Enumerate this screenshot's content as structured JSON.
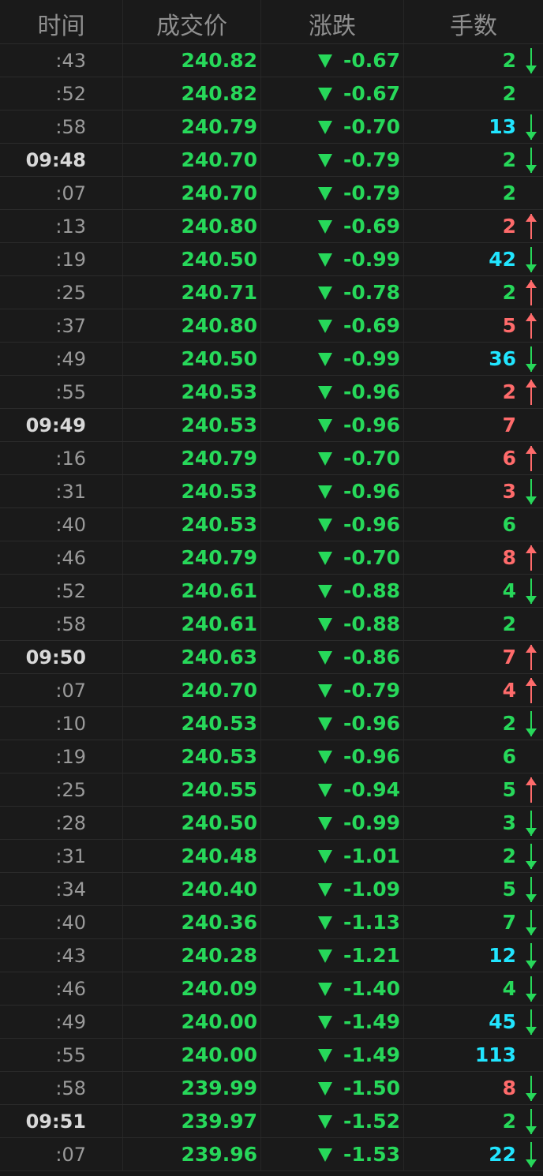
{
  "colors": {
    "background": "#1a1a1a",
    "header_text": "#8f8f8f",
    "time_text": "#9a9a9a",
    "minute_time_text": "#d8d8d8",
    "green": "#27d85a",
    "red": "#ff6b6b",
    "cyan": "#21e5ff"
  },
  "header": {
    "time": "时间",
    "price": "成交价",
    "change": "涨跌",
    "volume": "手数"
  },
  "rows": [
    {
      "time": ":43",
      "minute": false,
      "price": "240.82",
      "change": "-0.67",
      "volume": "2",
      "volume_color": "green",
      "arrow": "down"
    },
    {
      "time": ":52",
      "minute": false,
      "price": "240.82",
      "change": "-0.67",
      "volume": "2",
      "volume_color": "green",
      "arrow": ""
    },
    {
      "time": ":58",
      "minute": false,
      "price": "240.79",
      "change": "-0.70",
      "volume": "13",
      "volume_color": "cyan",
      "arrow": "down"
    },
    {
      "time": "09:48",
      "minute": true,
      "price": "240.70",
      "change": "-0.79",
      "volume": "2",
      "volume_color": "green",
      "arrow": "down"
    },
    {
      "time": ":07",
      "minute": false,
      "price": "240.70",
      "change": "-0.79",
      "volume": "2",
      "volume_color": "green",
      "arrow": ""
    },
    {
      "time": ":13",
      "minute": false,
      "price": "240.80",
      "change": "-0.69",
      "volume": "2",
      "volume_color": "red",
      "arrow": "up"
    },
    {
      "time": ":19",
      "minute": false,
      "price": "240.50",
      "change": "-0.99",
      "volume": "42",
      "volume_color": "cyan",
      "arrow": "down"
    },
    {
      "time": ":25",
      "minute": false,
      "price": "240.71",
      "change": "-0.78",
      "volume": "2",
      "volume_color": "green",
      "arrow": "up"
    },
    {
      "time": ":37",
      "minute": false,
      "price": "240.80",
      "change": "-0.69",
      "volume": "5",
      "volume_color": "red",
      "arrow": "up"
    },
    {
      "time": ":49",
      "minute": false,
      "price": "240.50",
      "change": "-0.99",
      "volume": "36",
      "volume_color": "cyan",
      "arrow": "down"
    },
    {
      "time": ":55",
      "minute": false,
      "price": "240.53",
      "change": "-0.96",
      "volume": "2",
      "volume_color": "red",
      "arrow": "up"
    },
    {
      "time": "09:49",
      "minute": true,
      "price": "240.53",
      "change": "-0.96",
      "volume": "7",
      "volume_color": "red",
      "arrow": ""
    },
    {
      "time": ":16",
      "minute": false,
      "price": "240.79",
      "change": "-0.70",
      "volume": "6",
      "volume_color": "red",
      "arrow": "up"
    },
    {
      "time": ":31",
      "minute": false,
      "price": "240.53",
      "change": "-0.96",
      "volume": "3",
      "volume_color": "red",
      "arrow": "down"
    },
    {
      "time": ":40",
      "minute": false,
      "price": "240.53",
      "change": "-0.96",
      "volume": "6",
      "volume_color": "green",
      "arrow": ""
    },
    {
      "time": ":46",
      "minute": false,
      "price": "240.79",
      "change": "-0.70",
      "volume": "8",
      "volume_color": "red",
      "arrow": "up"
    },
    {
      "time": ":52",
      "minute": false,
      "price": "240.61",
      "change": "-0.88",
      "volume": "4",
      "volume_color": "green",
      "arrow": "down"
    },
    {
      "time": ":58",
      "minute": false,
      "price": "240.61",
      "change": "-0.88",
      "volume": "2",
      "volume_color": "green",
      "arrow": ""
    },
    {
      "time": "09:50",
      "minute": true,
      "price": "240.63",
      "change": "-0.86",
      "volume": "7",
      "volume_color": "red",
      "arrow": "up"
    },
    {
      "time": ":07",
      "minute": false,
      "price": "240.70",
      "change": "-0.79",
      "volume": "4",
      "volume_color": "red",
      "arrow": "up"
    },
    {
      "time": ":10",
      "minute": false,
      "price": "240.53",
      "change": "-0.96",
      "volume": "2",
      "volume_color": "green",
      "arrow": "down"
    },
    {
      "time": ":19",
      "minute": false,
      "price": "240.53",
      "change": "-0.96",
      "volume": "6",
      "volume_color": "green",
      "arrow": ""
    },
    {
      "time": ":25",
      "minute": false,
      "price": "240.55",
      "change": "-0.94",
      "volume": "5",
      "volume_color": "green",
      "arrow": "up"
    },
    {
      "time": ":28",
      "minute": false,
      "price": "240.50",
      "change": "-0.99",
      "volume": "3",
      "volume_color": "green",
      "arrow": "down"
    },
    {
      "time": ":31",
      "minute": false,
      "price": "240.48",
      "change": "-1.01",
      "volume": "2",
      "volume_color": "green",
      "arrow": "down"
    },
    {
      "time": ":34",
      "minute": false,
      "price": "240.40",
      "change": "-1.09",
      "volume": "5",
      "volume_color": "green",
      "arrow": "down"
    },
    {
      "time": ":40",
      "minute": false,
      "price": "240.36",
      "change": "-1.13",
      "volume": "7",
      "volume_color": "green",
      "arrow": "down"
    },
    {
      "time": ":43",
      "minute": false,
      "price": "240.28",
      "change": "-1.21",
      "volume": "12",
      "volume_color": "cyan",
      "arrow": "down"
    },
    {
      "time": ":46",
      "minute": false,
      "price": "240.09",
      "change": "-1.40",
      "volume": "4",
      "volume_color": "green",
      "arrow": "down"
    },
    {
      "time": ":49",
      "minute": false,
      "price": "240.00",
      "change": "-1.49",
      "volume": "45",
      "volume_color": "cyan",
      "arrow": "down"
    },
    {
      "time": ":55",
      "minute": false,
      "price": "240.00",
      "change": "-1.49",
      "volume": "113",
      "volume_color": "cyan",
      "arrow": ""
    },
    {
      "time": ":58",
      "minute": false,
      "price": "239.99",
      "change": "-1.50",
      "volume": "8",
      "volume_color": "red",
      "arrow": "down"
    },
    {
      "time": "09:51",
      "minute": true,
      "price": "239.97",
      "change": "-1.52",
      "volume": "2",
      "volume_color": "green",
      "arrow": "down"
    },
    {
      "time": ":07",
      "minute": false,
      "price": "239.96",
      "change": "-1.53",
      "volume": "22",
      "volume_color": "cyan",
      "arrow": "down"
    }
  ]
}
